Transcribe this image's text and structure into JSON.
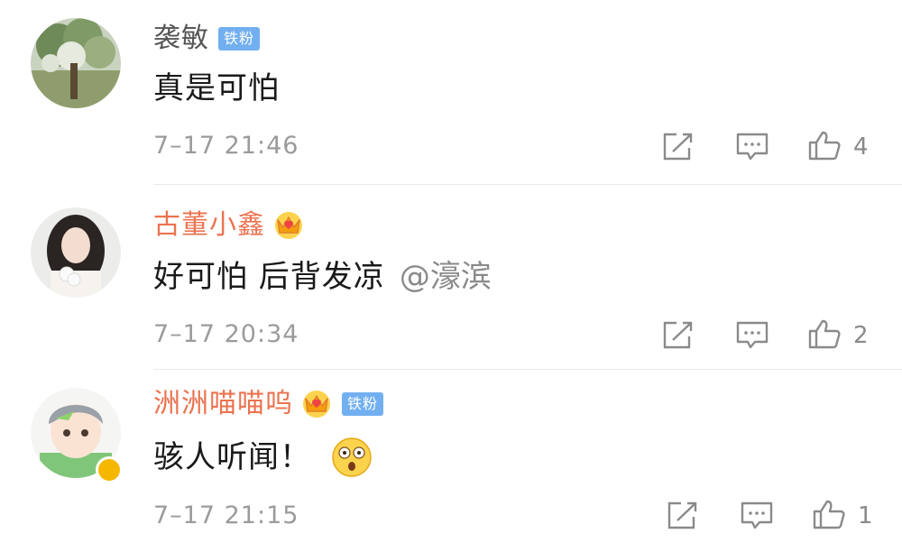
{
  "comments": [
    {
      "username": "袭敏",
      "badge": "铁粉",
      "text": "真是可怕",
      "time": "7–17 21:46",
      "likes": "4"
    },
    {
      "username": "古董小鑫",
      "text": "好可怕 后背发凉",
      "time": "7–17 20:34",
      "likes": "2"
    },
    {
      "username": "洲洲喵喵呜",
      "badge": "铁粉",
      "text": "骇人听闻！",
      "time": "7–17 21:15",
      "likes": "1"
    }
  ],
  "watermark": "@濠滨",
  "colors": {
    "vip_name": "#eb7350",
    "plain_name": "#555555",
    "badge_bg": "#72aff0",
    "meta": "#9b9b9b"
  },
  "icons": [
    "forward-icon",
    "comment-icon",
    "like-thumb-icon",
    "crown-icon",
    "verified-icon",
    "shocked-emoji-icon"
  ]
}
